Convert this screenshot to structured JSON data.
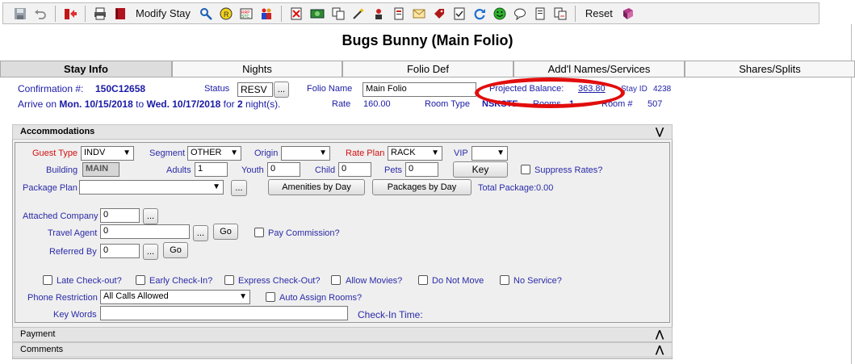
{
  "toolbar": {
    "modify_stay": "Modify Stay",
    "reset": "Reset"
  },
  "page": {
    "title": "Bugs Bunny (Main Folio)"
  },
  "tabs": [
    "Stay Info",
    "Nights",
    "Folio Def",
    "Add'l Names/Services",
    "Shares/Splits"
  ],
  "stay": {
    "confirmation_label": "Confirmation #:",
    "confirmation_value": "150C12658",
    "status_label": "Status",
    "status_value": "RESV",
    "folio_name_label": "Folio Name",
    "folio_name_value": "Main Folio",
    "projected_balance_label": "Projected Balance:",
    "projected_balance_value": "363.80",
    "stay_id_label": "Stay ID",
    "stay_id_value": "4238",
    "arrive_prefix": "Arrive on",
    "arrive_date": "Mon. 10/15/2018",
    "to_word": "to",
    "depart_date": "Wed. 10/17/2018",
    "for_word": "for",
    "nights": "2",
    "nights_suffix": "night(s).",
    "rate_label": "Rate",
    "rate_value": "160.00",
    "room_type_label": "Room Type",
    "room_type_value": "NSKSTE",
    "rooms_label": "Rooms",
    "rooms_value": "1",
    "room_no_label": "Room #",
    "room_no_value": "507"
  },
  "accommodations": {
    "header": "Accommodations",
    "guest_type_label": "Guest Type",
    "guest_type_value": "INDV",
    "segment_label": "Segment",
    "segment_value": "OTHER",
    "origin_label": "Origin",
    "origin_value": "",
    "rate_plan_label": "Rate Plan",
    "rate_plan_value": "RACK",
    "vip_label": "VIP",
    "vip_value": "",
    "building_label": "Building",
    "building_value": "MAIN",
    "adults_label": "Adults",
    "adults_value": "1",
    "youth_label": "Youth",
    "youth_value": "0",
    "child_label": "Child",
    "child_value": "0",
    "pets_label": "Pets",
    "pets_value": "0",
    "key_button": "Key",
    "suppress_rates": "Suppress Rates?",
    "package_plan_label": "Package Plan",
    "package_plan_value": "",
    "amenities_button": "Amenities by Day",
    "packages_button": "Packages by Day",
    "total_package_label": "Total Package:",
    "total_package_value": "0.00",
    "attached_company_label": "Attached Company",
    "attached_company_value": "0",
    "travel_agent_label": "Travel Agent",
    "travel_agent_value": "0",
    "pay_commission": "Pay Commission?",
    "referred_by_label": "Referred By",
    "referred_by_value": "0",
    "go_label": "Go",
    "ellipsis": "...",
    "late_checkout": "Late Check-out?",
    "early_checkin": "Early Check-In?",
    "express_checkout": "Express Check-Out?",
    "allow_movies": "Allow Movies?",
    "do_not_move": "Do Not Move",
    "no_service": "No Service?",
    "phone_restriction_label": "Phone Restriction",
    "phone_restriction_value": "All Calls Allowed",
    "auto_assign": "Auto Assign Rooms?",
    "key_words_label": "Key Words",
    "key_words_value": "",
    "checkin_time_label": "Check-In Time:"
  },
  "sections": {
    "payment": "Payment",
    "comments": "Comments"
  },
  "colors": {
    "label_blue": "#2a2aa8",
    "required_red": "#d21010",
    "highlight_oval": "#e20d0d"
  }
}
